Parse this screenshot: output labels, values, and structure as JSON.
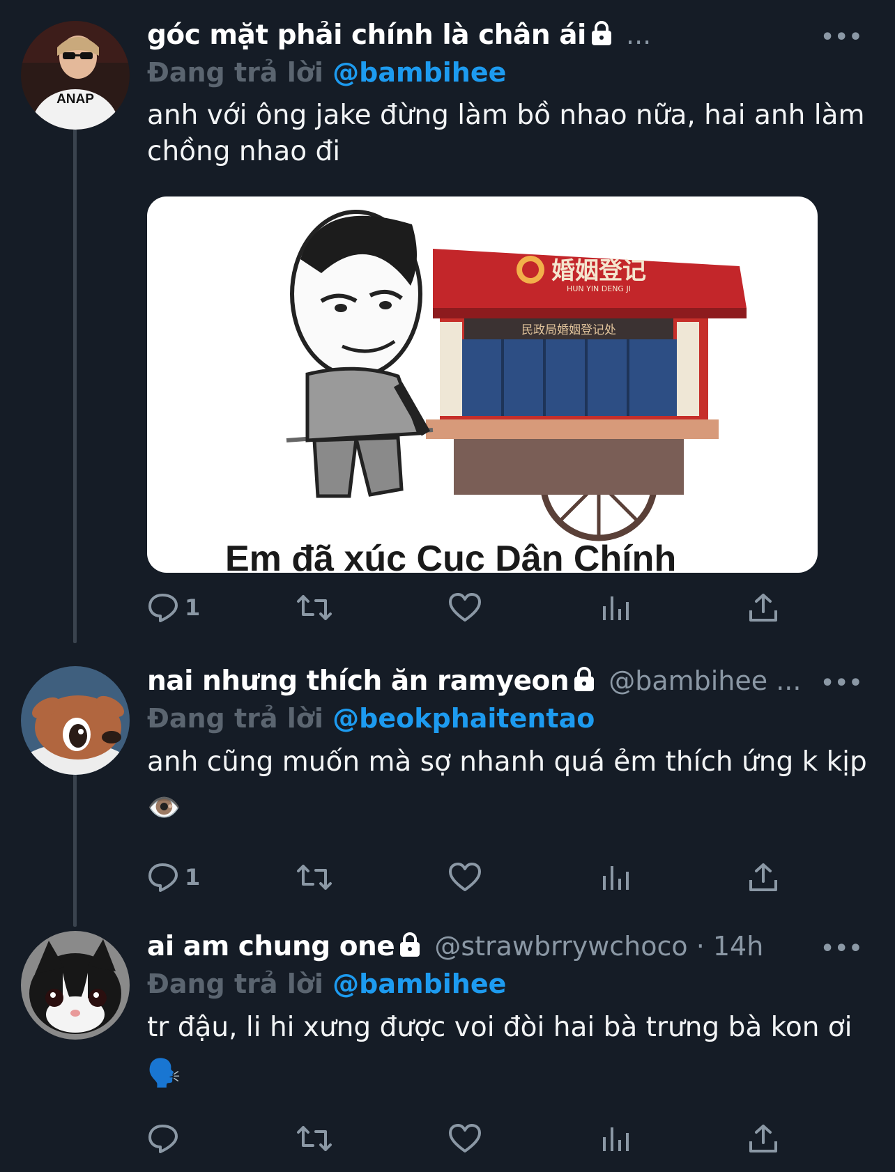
{
  "theme": {
    "background": "#151c26",
    "mention_color": "#1d9bf0",
    "muted": "#8b98a5"
  },
  "tweets": [
    {
      "name": "góc mặt phải chính là chân ái",
      "handle": "...",
      "more": "•••",
      "replying_prefix": "Đang trả lời",
      "replying_to": "@bambihee",
      "text": "anh với ông jake đừng làm bồ nhao nữa, hai anh làm chồng nhao đi",
      "media_caption": "Em đã xúc Cục Dân Chính",
      "media_sign": "婚姻登记",
      "media_sign_sub": "HUN YIN DENG JI",
      "media_banner": "民政局婚姻登记处",
      "reply_count": "1",
      "avatar_shirt_text": "ANAP"
    },
    {
      "name": "nai nhưng thích ăn ramyeon",
      "handle": "@bambihee ...",
      "more": "•••",
      "replying_prefix": "Đang trả lời",
      "replying_to": "@beokphaitentao",
      "text": "anh cũng muốn mà sợ nhanh quá ẻm thích ứng k kịp👁️",
      "reply_count": "1"
    },
    {
      "name": "ai am chung one",
      "handle": "@strawbrrywchoco · 14h",
      "more": "•••",
      "replying_prefix": "Đang trả lời",
      "replying_to": "@bambihee",
      "text": "tr đậu, li hi xưng được voi đòi hai bà trưng bà kon ơi🗣️",
      "reply_count": ""
    }
  ]
}
